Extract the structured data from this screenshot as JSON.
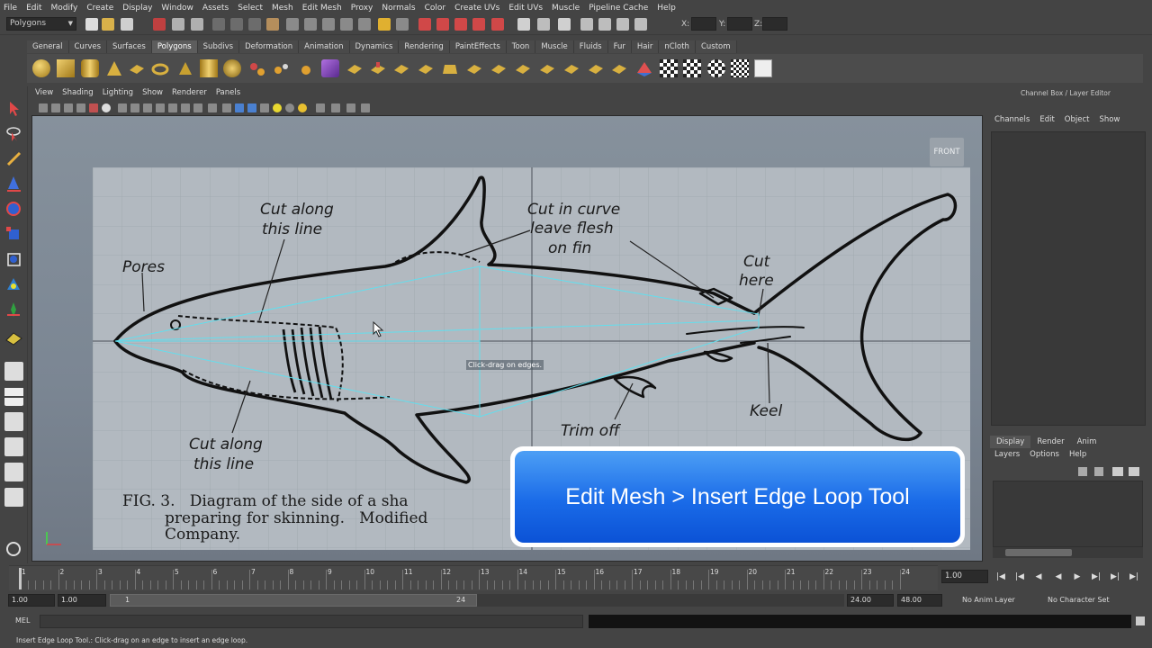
{
  "menubar": {
    "items": [
      "File",
      "Edit",
      "Modify",
      "Create",
      "Display",
      "Window",
      "Assets",
      "Select",
      "Mesh",
      "Edit Mesh",
      "Proxy",
      "Normals",
      "Color",
      "Create UVs",
      "Edit UVs",
      "Muscle",
      "Pipeline Cache",
      "Help"
    ]
  },
  "statusline": {
    "mode": "Polygons",
    "x_label": "X:",
    "y_label": "Y:",
    "z_label": "Z:"
  },
  "shelf": {
    "tabs": [
      "General",
      "Curves",
      "Surfaces",
      "Polygons",
      "Subdivs",
      "Deformation",
      "Animation",
      "Dynamics",
      "Rendering",
      "PaintEffects",
      "Toon",
      "Muscle",
      "Fluids",
      "Fur",
      "Hair",
      "nCloth",
      "Custom"
    ],
    "active_tab": "Polygons"
  },
  "viewport": {
    "menu": [
      "View",
      "Shading",
      "Lighting",
      "Show",
      "Renderer",
      "Panels"
    ],
    "camera_label": "FRONT",
    "tooltip": "Click-drag on edges.",
    "reference_image": {
      "labels": {
        "pores": "Pores",
        "cut_along_top_1": "Cut along",
        "cut_along_top_2": "this line",
        "cut_in_curve_1": "Cut in curve",
        "cut_in_curve_2": "leave flesh",
        "cut_in_curve_3": "on fin",
        "cut_here_1": "Cut",
        "cut_here_2": "here",
        "keel": "Keel",
        "trim_off": "Trim off",
        "cut_along_bottom_1": "Cut along",
        "cut_along_bottom_2": "this line"
      },
      "caption_1": "FIG. 3.   Diagram of the side of a sha",
      "caption_2": "preparing for skinning.   Modified",
      "caption_3": "Company."
    }
  },
  "callout": {
    "text": "Edit Mesh > Insert Edge Loop Tool"
  },
  "right_panel": {
    "title": "Channel Box / Layer Editor",
    "menu": [
      "Channels",
      "Edit",
      "Object",
      "Show"
    ],
    "layer_tabs": [
      "Display",
      "Render",
      "Anim"
    ],
    "active_layer_tab": "Display",
    "layer_menu": [
      "Layers",
      "Options",
      "Help"
    ]
  },
  "timeline": {
    "ticks": [
      "1",
      "2",
      "3",
      "4",
      "5",
      "6",
      "7",
      "8",
      "9",
      "10",
      "11",
      "12",
      "13",
      "14",
      "15",
      "16",
      "17",
      "18",
      "19",
      "20",
      "21",
      "22",
      "23",
      "24"
    ],
    "current_frame": "1.00"
  },
  "range": {
    "start": "1.00",
    "playback_start": "1.00",
    "handle_start": "1",
    "handle_end": "24",
    "playback_end": "24.00",
    "end": "48.00",
    "anim_layer": "No Anim Layer",
    "character_set": "No Character Set"
  },
  "cmdline": {
    "label": "MEL"
  },
  "helpline": {
    "text": "Insert Edge Loop Tool.: Click-drag on an edge to insert an edge loop."
  },
  "colors": {
    "ui_bg": "#444444",
    "viewport_bg": "#7b8693",
    "callout_blue": "#1a6be8",
    "wire_cyan": "#5fe0f0"
  }
}
